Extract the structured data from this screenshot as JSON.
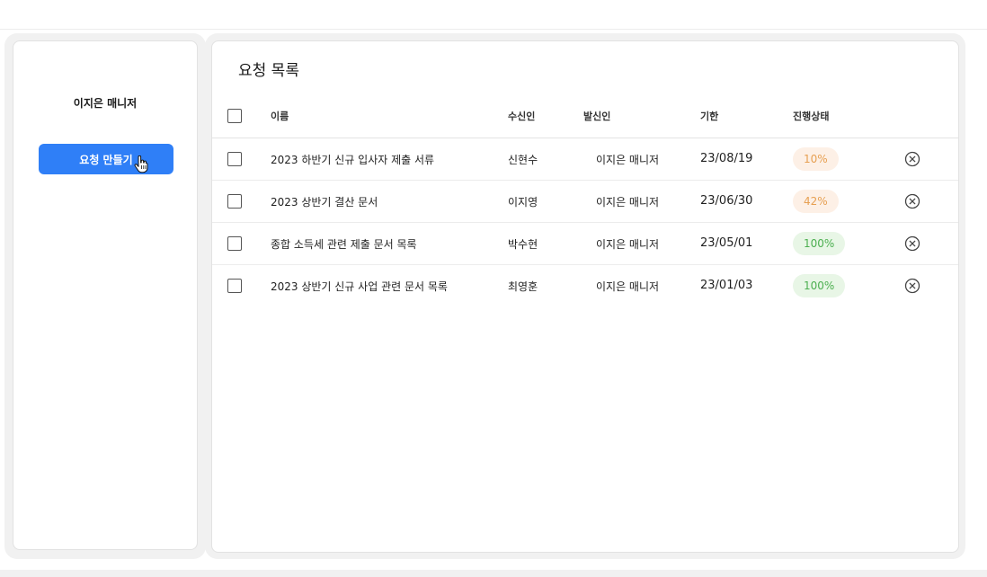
{
  "sidebar": {
    "user_name": "이지은 매니저",
    "create_button_label": "요청 만들기"
  },
  "main": {
    "title": "요청 목록",
    "columns": [
      "이름",
      "수신인",
      "발신인",
      "기한",
      "진행상태"
    ],
    "rows": [
      {
        "title": "2023 하반기 신규 입사자 제출 서류",
        "recipient": "신현수",
        "sender": "이지은 매니저",
        "deadline": "23/08/19",
        "progress": "10%",
        "status_color": "#e7a052",
        "status_bg": "#fdf0e6"
      },
      {
        "title": "2023 상반기 결산 문서",
        "recipient": "이지영",
        "sender": "이지은 매니저",
        "deadline": "23/06/30",
        "progress": "42%",
        "status_color": "#e7a052",
        "status_bg": "#fdf0e6"
      },
      {
        "title": "종합 소득세 관련 제출 문서 목록",
        "recipient": "박수현",
        "sender": "이지은 매니저",
        "deadline": "23/05/01",
        "progress": "100%",
        "status_color": "#4caf50",
        "status_bg": "#e8f6e6"
      },
      {
        "title": "2023 상반기 신규 사업 관련 문서 목록",
        "recipient": "최영훈",
        "sender": "이지은 매니저",
        "deadline": "23/01/03",
        "progress": "100%",
        "status_color": "#4caf50",
        "status_bg": "#e8f6e6"
      }
    ]
  },
  "colors": {
    "accent": "#2f7ff7",
    "in_progress": "#e7a052",
    "complete": "#4caf50"
  },
  "icons": {
    "delete": "close-circle-icon",
    "cursor": "hand-pointer-icon"
  }
}
